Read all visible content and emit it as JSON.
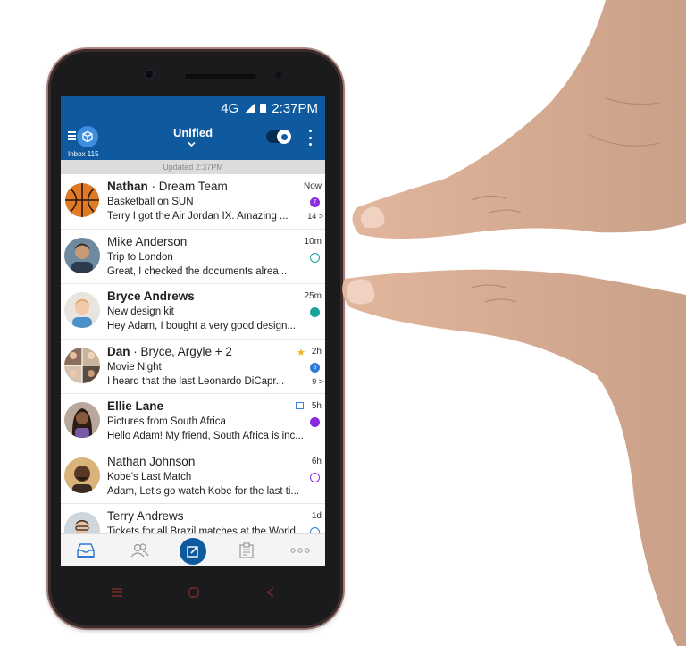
{
  "status": {
    "network": "4G",
    "time": "2:37PM"
  },
  "appbar": {
    "inbox_label": "Inbox 115",
    "title": "Unified"
  },
  "updated": "Updated 2:37PM",
  "messages": [
    {
      "sender": "Nathan",
      "group": " · Dream Team",
      "subject": "Basketball on SUN",
      "preview": "Terry I got the Air Jordan IX. Amazing ...",
      "time": "Now",
      "count": "14 >",
      "marker": "7",
      "marker_color": "#8a2be2",
      "unread": true
    },
    {
      "sender": "Mike Anderson",
      "group": "",
      "subject": "Trip to London",
      "preview": "Great, I checked the documents alrea...",
      "time": "10m",
      "count": "",
      "marker": "",
      "marker_color": "#1aa39a",
      "unread": false
    },
    {
      "sender": "Bryce Andrews",
      "group": "",
      "subject": "New design kit",
      "preview": "Hey Adam, I bought a very good design...",
      "time": "25m",
      "count": "",
      "marker": "",
      "marker_color": "#1aa39a",
      "unread": true
    },
    {
      "sender": "Dan",
      "group": " · Bryce, Argyle + 2",
      "subject": "Movie Night",
      "preview": "I heard that the last Leonardo DiCapr...",
      "time": "2h",
      "count": "9 >",
      "marker": "6",
      "marker_color": "#2d7ad6",
      "unread": true
    },
    {
      "sender": "Ellie Lane",
      "group": "",
      "subject": "Pictures from South Africa",
      "preview": "Hello Adam! My friend, South Africa is inc...",
      "time": "5h",
      "count": "",
      "marker": "",
      "marker_color": "#8a2be2",
      "unread": true
    },
    {
      "sender": "Nathan Johnson",
      "group": "",
      "subject": "Kobe's Last Match",
      "preview": "Adam, Let's go watch Kobe for the last ti...",
      "time": "6h",
      "count": "",
      "marker": "",
      "marker_color": "#8a2be2",
      "unread": false
    },
    {
      "sender": "Terry Andrews",
      "group": "",
      "subject": "Tickets for all Brazil matches at the World...",
      "preview": "",
      "time": "1d",
      "count": "",
      "marker": "",
      "marker_color": "#2d7ad6",
      "unread": false
    }
  ],
  "icons": {
    "inbox": "inbox-icon",
    "chevron": "chevron-down-icon",
    "toggle": "focus-toggle",
    "menu": "more-vert-icon",
    "tab_mail": "mail-tray-icon",
    "tab_people": "people-icon",
    "tab_compose": "compose-icon",
    "tab_files": "clipboard-icon",
    "tab_more": "more-horiz-icon"
  },
  "colors": {
    "brand": "#0f5a9e",
    "accent": "#3d8ee0"
  }
}
